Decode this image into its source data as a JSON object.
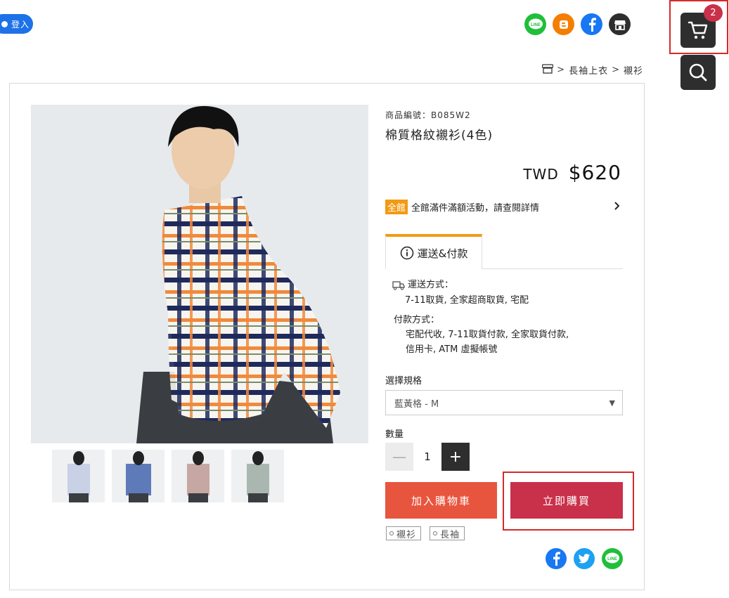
{
  "header": {
    "login_label": "登入",
    "cart_count": "2",
    "social_icons": [
      "line-icon",
      "blogger-icon",
      "facebook-icon",
      "store-icon"
    ]
  },
  "breadcrumb": {
    "items": [
      "長袖上衣",
      "襯衫"
    ]
  },
  "product": {
    "sku": "商品編號：B085W2",
    "name": "棉質格紋襯衫(4色)",
    "currency": "TWD",
    "price": "$620",
    "promo_badge": "全館",
    "promo_text": "全館滿件滿額活動，請查閱詳情",
    "tab_label": "運送&付款",
    "shipping_title": "運送方式：",
    "shipping_methods": "7-11取貨, 全家超商取貨, 宅配",
    "payment_title": "付款方式：",
    "payment_methods_1": "宅配代收, 7-11取貨付款, 全家取貨付款,",
    "payment_methods_2": "信用卡, ATM 虛擬帳號",
    "spec_label": "選擇規格",
    "spec_value": "藍黃格 - M",
    "qty_label": "數量",
    "qty_value": "1",
    "add_to_cart": "加入購物車",
    "buy_now": "立即購買",
    "tags": [
      "襯衫",
      "長袖"
    ]
  },
  "colors": {
    "primary_blue": "#1d72e8",
    "cart_dark": "#2e2e2e",
    "badge_red": "#c9304a",
    "add_cart_orange": "#e8553e",
    "promo_orange": "#f29a14",
    "highlight_red": "#d42a2a"
  }
}
